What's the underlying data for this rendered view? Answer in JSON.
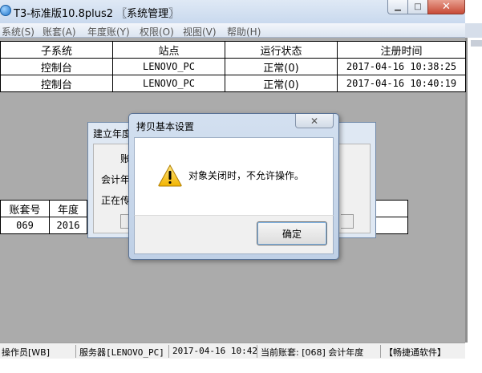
{
  "window": {
    "title": "T3-标准版10.8plus2 〖系统管理〗",
    "min_glyph": "▁",
    "max_glyph": "□",
    "close_glyph": "✕",
    "icon": "app-globe-icon"
  },
  "menu": [
    {
      "label": "系统(S)"
    },
    {
      "label": "账套(A)"
    },
    {
      "label": "年度账(Y)"
    },
    {
      "label": "权限(O)"
    },
    {
      "label": "视图(V)"
    },
    {
      "label": "帮助(H)"
    }
  ],
  "session_table": {
    "headers": [
      "子系统",
      "站点",
      "运行状态",
      "注册时间"
    ],
    "rows": [
      [
        "控制台",
        "LENOVO_PC",
        "正常(0)",
        "2017-04-16 10:38:25"
      ],
      [
        "控制台",
        "LENOVO_PC",
        "正常(0)",
        "2017-04-16 10:40:19"
      ]
    ]
  },
  "account_table": {
    "headers": [
      "账套号",
      "年度"
    ],
    "rows": [
      [
        "069",
        "2016"
      ]
    ]
  },
  "build_dialog": {
    "title": "建立年度",
    "line1": "账",
    "line2": "会计年",
    "line3": "正在传"
  },
  "copy_dialog": {
    "title": "拷贝基本设置",
    "close_glyph": "✕",
    "message": "对象关闭时，不允许操作。",
    "ok_label": "确定",
    "icon": "warning-icon"
  },
  "status": {
    "operator": "操作员[WB]",
    "server": "服务器[LENOVO_PC]",
    "datetime": "2017-04-16 10:42",
    "current_account": "当前账套: [068] 会计年度",
    "brand": "【畅捷通软件】"
  }
}
